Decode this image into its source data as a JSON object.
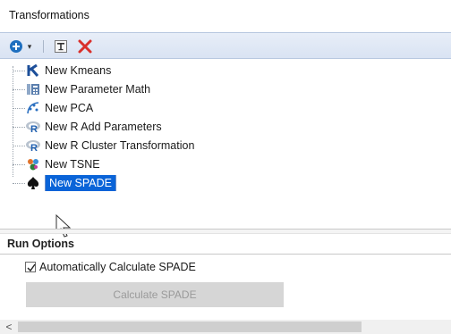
{
  "panel": {
    "title": "Transformations"
  },
  "toolbar": {
    "add_icon": "plus-circle-icon",
    "dropdown_glyph": "▾",
    "text_icon": "text-icon",
    "delete_icon": "delete-x-icon"
  },
  "tree": {
    "items": [
      {
        "label": "New Kmeans",
        "icon": "kmeans-icon"
      },
      {
        "label": "New Parameter Math",
        "icon": "parameter-math-icon"
      },
      {
        "label": "New PCA",
        "icon": "pca-icon"
      },
      {
        "label": "New R Add Parameters",
        "icon": "r-icon"
      },
      {
        "label": "New R Cluster Transformation",
        "icon": "r-icon"
      },
      {
        "label": "New TSNE",
        "icon": "tsne-icon"
      },
      {
        "label": "New SPADE",
        "icon": "spade-icon",
        "selected": true
      }
    ]
  },
  "run_options": {
    "header": "Run Options",
    "auto_calc_label": "Automatically Calculate SPADE",
    "auto_calc_checked": true,
    "calculate_button": "Calculate SPADE"
  },
  "scrollbar": {
    "left_arrow": "<"
  },
  "colors": {
    "selection": "#0a64d8",
    "delete": "#d9302c",
    "toolbar": "#dde6f4"
  }
}
